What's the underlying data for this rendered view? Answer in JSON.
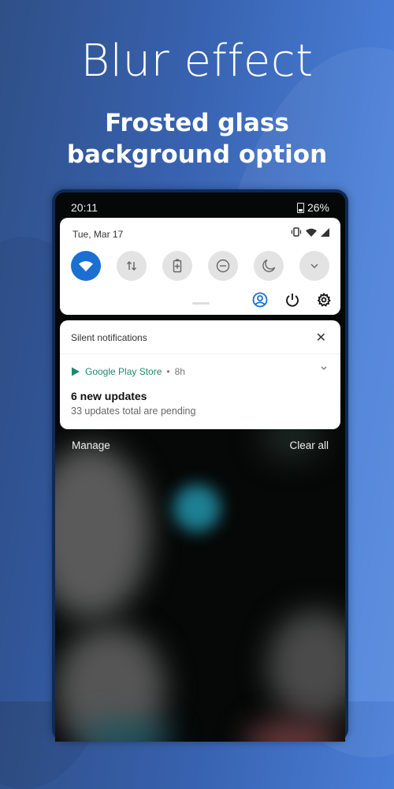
{
  "promo": {
    "headline": "Blur effect",
    "subhead_line1": "Frosted glass",
    "subhead_line2": "background option"
  },
  "statusbar": {
    "time": "20:11",
    "battery": "26%"
  },
  "quick_settings": {
    "date": "Tue, Mar 17",
    "status_icons": [
      "vibrate-icon",
      "wifi-icon",
      "cell-signal-icon"
    ],
    "tiles": [
      {
        "name": "wifi",
        "active": true
      },
      {
        "name": "mobile-data",
        "active": false
      },
      {
        "name": "battery-saver",
        "active": false
      },
      {
        "name": "do-not-disturb",
        "active": false
      },
      {
        "name": "night-mode",
        "active": false
      },
      {
        "name": "expand",
        "active": false
      }
    ],
    "accent": "#1a6fd1"
  },
  "notifications": {
    "section_title": "Silent notifications",
    "items": [
      {
        "app": "Google Play Store",
        "separator": "•",
        "time": "8h",
        "title": "6 new updates",
        "body": "33 updates total are pending",
        "app_color": "#1a8a6f"
      }
    ],
    "manage_label": "Manage",
    "clear_all_label": "Clear all"
  }
}
